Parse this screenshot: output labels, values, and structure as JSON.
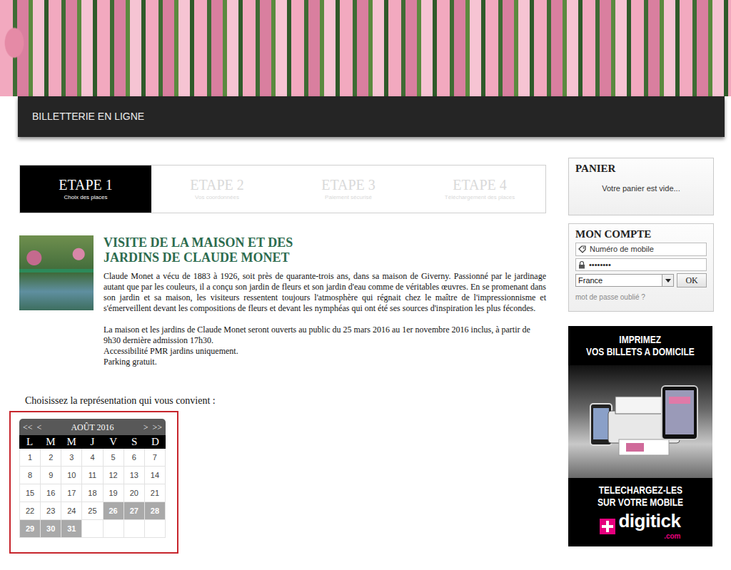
{
  "banner": {
    "title": "BILLETTERIE EN LIGNE"
  },
  "steps": [
    {
      "label": "ETAPE 1",
      "sub": "Choix des places",
      "selected": true
    },
    {
      "label": "ETAPE 2",
      "sub": "Vos coordonnées",
      "selected": false
    },
    {
      "label": "ETAPE 3",
      "sub": "Paiement sécurisé",
      "selected": false
    },
    {
      "label": "ETAPE 4",
      "sub": "Téléchargement des places",
      "selected": false
    }
  ],
  "event": {
    "title": "VISITE DE LA MAISON ET DES JARDINS DE CLAUDE MONET",
    "description": "Claude Monet a vécu de 1883 à 1926, soit près de quarante-trois ans, dans sa maison de Giverny. Passionné par le jardinage autant que par les couleurs, il a conçu son jardin de fleurs et son jardin d'eau comme de véritables œuvres. En se promenant dans son jardin et sa maison, les visiteurs ressentent toujours l'atmosphère qui régnait chez le maître de l'impressionnisme et s'émerveillent devant les compositions de fleurs et devant les nymphéas qui ont été ses sources d'inspiration les plus fécondes.",
    "info": [
      "La maison et les jardins de Claude Monet seront ouverts au public du 25 mars 2016 au 1er novembre 2016 inclus, à partir de 9h30 dernière admission 17h30.",
      "Accessibilité PMR jardins uniquement.",
      "Parking gratuit."
    ]
  },
  "calendar": {
    "prompt": "Choisissez la représentation qui vous convient :",
    "prev_year": "<<",
    "prev_month": "<",
    "month": "AOÛT 2016",
    "next_month": ">",
    "next_year": ">>",
    "weekdays": [
      "L",
      "M",
      "M",
      "J",
      "V",
      "S",
      "D"
    ],
    "days": [
      {
        "label": "1",
        "available": false
      },
      {
        "label": "2",
        "available": false
      },
      {
        "label": "3",
        "available": false
      },
      {
        "label": "4",
        "available": false
      },
      {
        "label": "5",
        "available": false
      },
      {
        "label": "6",
        "available": false
      },
      {
        "label": "7",
        "available": false
      },
      {
        "label": "8",
        "available": false
      },
      {
        "label": "9",
        "available": false
      },
      {
        "label": "10",
        "available": false
      },
      {
        "label": "11",
        "available": false
      },
      {
        "label": "12",
        "available": false
      },
      {
        "label": "13",
        "available": false
      },
      {
        "label": "14",
        "available": false
      },
      {
        "label": "15",
        "available": false
      },
      {
        "label": "16",
        "available": false
      },
      {
        "label": "17",
        "available": false
      },
      {
        "label": "18",
        "available": false
      },
      {
        "label": "19",
        "available": false
      },
      {
        "label": "20",
        "available": false
      },
      {
        "label": "21",
        "available": false
      },
      {
        "label": "22",
        "available": false
      },
      {
        "label": "23",
        "available": false
      },
      {
        "label": "24",
        "available": false
      },
      {
        "label": "25",
        "available": false
      },
      {
        "label": "26",
        "available": true
      },
      {
        "label": "27",
        "available": true
      },
      {
        "label": "28",
        "available": true
      },
      {
        "label": "29",
        "available": true
      },
      {
        "label": "30",
        "available": true
      },
      {
        "label": "31",
        "available": true
      }
    ]
  },
  "cart": {
    "title": "PANIER",
    "empty_text": "Votre panier est vide..."
  },
  "account": {
    "title": "MON COMPTE",
    "phone_placeholder": "Numéro de mobile",
    "password": "••••••••",
    "country": "France",
    "submit": "OK",
    "forgot": "mot de passe oublié ?"
  },
  "ad": {
    "headline": [
      "IMPRIMEZ",
      "VOS BILLETS A DOMICILE"
    ],
    "footer": [
      "TELECHARGEZ-LES",
      "SUR VOTRE MOBILE"
    ],
    "brand": "digitick",
    "brand_suffix": ".com"
  }
}
